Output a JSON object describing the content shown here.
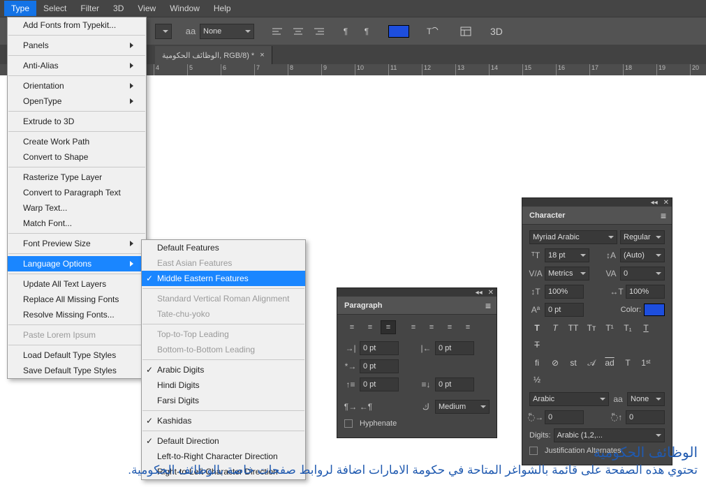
{
  "menubar": {
    "items": [
      "Type",
      "Select",
      "Filter",
      "3D",
      "View",
      "Window",
      "Help"
    ],
    "active": 0
  },
  "toolbar": {
    "aa_label": "aa",
    "aa_value": "None",
    "threeD": "3D"
  },
  "tab": {
    "label": "الوظائف الحكومية, RGB/8) *"
  },
  "ruler": [
    "4",
    "5",
    "6",
    "7",
    "8",
    "9",
    "10",
    "11",
    "12",
    "13",
    "14",
    "15",
    "16",
    "17",
    "18",
    "19",
    "20"
  ],
  "type_menu": {
    "items": [
      {
        "t": "Add Fonts from Typekit..."
      },
      "sep",
      {
        "t": "Panels",
        "sub": true
      },
      "sep",
      {
        "t": "Anti-Alias",
        "sub": true
      },
      "sep",
      {
        "t": "Orientation",
        "sub": true
      },
      {
        "t": "OpenType",
        "sub": true
      },
      "sep",
      {
        "t": "Extrude to 3D"
      },
      "sep",
      {
        "t": "Create Work Path"
      },
      {
        "t": "Convert to Shape"
      },
      "sep",
      {
        "t": "Rasterize Type Layer"
      },
      {
        "t": "Convert to Paragraph Text"
      },
      {
        "t": "Warp Text..."
      },
      {
        "t": "Match Font..."
      },
      "sep",
      {
        "t": "Font Preview Size",
        "sub": true
      },
      "sep",
      {
        "t": "Language Options",
        "sub": true,
        "hi": true
      },
      "sep",
      {
        "t": "Update All Text Layers"
      },
      {
        "t": "Replace All Missing Fonts"
      },
      {
        "t": "Resolve Missing Fonts..."
      },
      "sep",
      {
        "t": "Paste Lorem Ipsum",
        "dis": true
      },
      "sep",
      {
        "t": "Load Default Type Styles"
      },
      {
        "t": "Save Default Type Styles"
      }
    ]
  },
  "lang_submenu": {
    "items": [
      {
        "t": "Default Features"
      },
      {
        "t": "East Asian Features",
        "dis": true
      },
      {
        "t": "Middle Eastern Features",
        "hi": true,
        "check": true
      },
      "sep",
      {
        "t": "Standard Vertical Roman Alignment",
        "dis": true
      },
      {
        "t": "Tate-chu-yoko",
        "dis": true
      },
      "sep",
      {
        "t": "Top-to-Top Leading",
        "dis": true
      },
      {
        "t": "Bottom-to-Bottom Leading",
        "dis": true
      },
      "sep",
      {
        "t": "Arabic Digits",
        "check": true
      },
      {
        "t": "Hindi Digits"
      },
      {
        "t": "Farsi Digits"
      },
      "sep",
      {
        "t": "Kashidas",
        "check": true
      },
      "sep",
      {
        "t": "Default Direction",
        "check": true
      },
      {
        "t": "Left-to-Right Character Direction"
      },
      {
        "t": "Right-to-Left Character Direction"
      }
    ]
  },
  "paragraph": {
    "title": "Paragraph",
    "indent_left": "0 pt",
    "indent_right": "0 pt",
    "first_line": "0 pt",
    "space_before": "0 pt",
    "space_after": "0 pt",
    "kashida": "Medium",
    "hyphenate": "Hyphenate"
  },
  "character": {
    "title": "Character",
    "font": "Myriad Arabic",
    "style": "Regular",
    "size": "18 pt",
    "leading": "(Auto)",
    "kerning": "Metrics",
    "tracking": "0",
    "vscale": "100%",
    "hscale": "100%",
    "baseline": "0 pt",
    "color": "Color:",
    "script": "Arabic",
    "antialias": "None",
    "diac_x": "0",
    "diac_y": "0",
    "digits_label": "Digits:",
    "digits": "Arabic  (1,2,...",
    "justification": "Justification Alternates"
  },
  "canvas_text": {
    "title": "الوظائف الحكومية",
    "body": "تحتوي هذه الصفحة على قائمة بالشواغر المتاحة في حكومة الامارات اضافة لروابط صفحات خاصة بالوظائف الحكومية."
  }
}
